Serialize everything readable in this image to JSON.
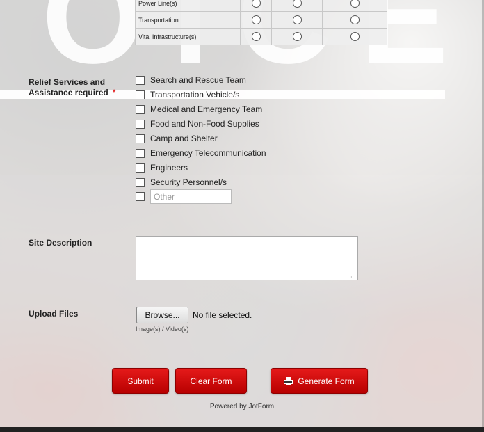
{
  "matrix": {
    "rows": [
      {
        "label": "Power Line(s)"
      },
      {
        "label": "Transportation"
      },
      {
        "label": "Vital Infrastructure(s)"
      }
    ]
  },
  "relief": {
    "label": "Relief Services and Assistance required",
    "required_mark": "*",
    "options": [
      "Search and Rescue Team",
      "Transportation Vehicle/s",
      "Medical and Emergency Team",
      "Food and Non-Food Supplies",
      "Camp and Shelter",
      "Emergency Telecommunication",
      "Engineers",
      "Security Personnel/s"
    ],
    "other_placeholder": "Other"
  },
  "site_description": {
    "label": "Site Description",
    "value": ""
  },
  "upload": {
    "label": "Upload Files",
    "browse_label": "Browse...",
    "status": "No file selected.",
    "sublabel": "Image(s) / Video(s)"
  },
  "buttons": {
    "submit": "Submit",
    "clear": "Clear Form",
    "generate": "Generate Form"
  },
  "footer": {
    "powered_by": "Powered by JotForm"
  },
  "colors": {
    "button_red": "#d40d0d",
    "required": "#dd0000"
  }
}
